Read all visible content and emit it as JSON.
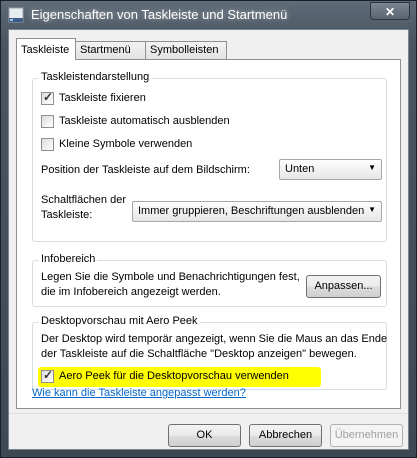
{
  "window": {
    "title": "Eigenschaften von Taskleiste und Startmenü",
    "close_glyph": "✕",
    "icon": "taskbar-properties-icon"
  },
  "tabs": [
    {
      "label": "Taskleiste",
      "selected": true
    },
    {
      "label": "Startmenü",
      "selected": false
    },
    {
      "label": "Symbolleisten",
      "selected": false
    }
  ],
  "taskbar_appearance": {
    "title": "Taskleistendarstellung",
    "lock_taskbar": {
      "label": "Taskleiste fixieren",
      "checked": true
    },
    "autohide": {
      "label": "Taskleiste automatisch ausblenden",
      "checked": false
    },
    "small_icons": {
      "label": "Kleine Symbole verwenden",
      "checked": false
    },
    "position_label": "Position der Taskleiste auf dem Bildschirm:",
    "position_value": "Unten",
    "buttons_label_line1": "Schaltflächen der",
    "buttons_label_line2": "Taskleiste:",
    "buttons_value": "Immer gruppieren, Beschriftungen ausblenden"
  },
  "notification_area": {
    "title": "Infobereich",
    "text_line1": "Legen Sie die Symbole und Benachrichtigungen fest,",
    "text_line2": "die im Infobereich angezeigt werden.",
    "customize_button": "Anpassen..."
  },
  "aero_peek": {
    "title": "Desktopvorschau mit Aero Peek",
    "text_line1": "Der Desktop wird temporär angezeigt, wenn Sie die Maus an das Ende",
    "text_line2": "der Taskleiste auf die Schaltfläche \"Desktop anzeigen\" bewegen.",
    "checkbox": {
      "label": "Aero Peek für die Desktopvorschau verwenden",
      "checked": true
    },
    "highlight_color": "#ffff00"
  },
  "help_link": "Wie kann die Taskleiste angepasst werden?",
  "footer": {
    "ok": "OK",
    "cancel": "Abbrechen",
    "apply": "Übernehmen",
    "apply_enabled": false
  },
  "checkmark_glyph": "✓",
  "dropdown_glyph": "▼"
}
